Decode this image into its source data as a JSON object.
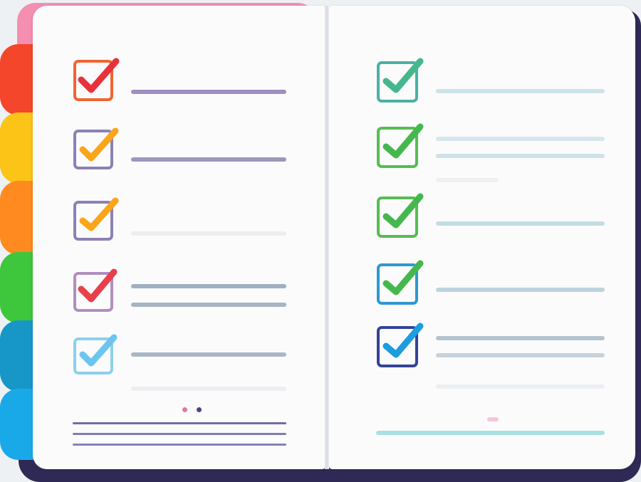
{
  "palette": {
    "cover": "#2e2a55",
    "page": "#fbfbfc",
    "tabs": [
      "#f4462a",
      "#fbc417",
      "#ff8a1f",
      "#3ec63c",
      "#1797c8",
      "#1aa9e8"
    ]
  },
  "left_page": {
    "items": [
      {
        "icon": "checkbox-checked-icon",
        "box_color": "#f06530",
        "check_color": "#e8323a",
        "lines": 1
      },
      {
        "icon": "checkbox-checked-icon",
        "box_color": "#8c81b3",
        "check_color": "#fba51a",
        "lines": 1
      },
      {
        "icon": "checkbox-checked-icon",
        "box_color": "#8c81b3",
        "check_color": "#fba51a",
        "lines": 0
      },
      {
        "icon": "checkbox-checked-icon",
        "box_color": "#b18ebf",
        "check_color": "#e8404a",
        "lines": 2
      },
      {
        "icon": "checkbox-checked-icon",
        "box_color": "#8cd0ee",
        "check_color": "#6cc5f0",
        "lines": 1
      }
    ]
  },
  "right_page": {
    "items": [
      {
        "icon": "checkbox-checked-icon",
        "box_color": "#4bb1a2",
        "check_color": "#46b78c",
        "lines": 1
      },
      {
        "icon": "checkbox-checked-icon",
        "box_color": "#55bd51",
        "check_color": "#44b84c",
        "lines": 2
      },
      {
        "icon": "checkbox-checked-icon",
        "box_color": "#55bd51",
        "check_color": "#44b84c",
        "lines": 1
      },
      {
        "icon": "checkbox-checked-icon",
        "box_color": "#2d99d2",
        "check_color": "#44b84c",
        "lines": 1
      },
      {
        "icon": "checkbox-checked-icon",
        "box_color": "#344396",
        "check_color": "#1b9de0",
        "lines": 2
      }
    ]
  }
}
